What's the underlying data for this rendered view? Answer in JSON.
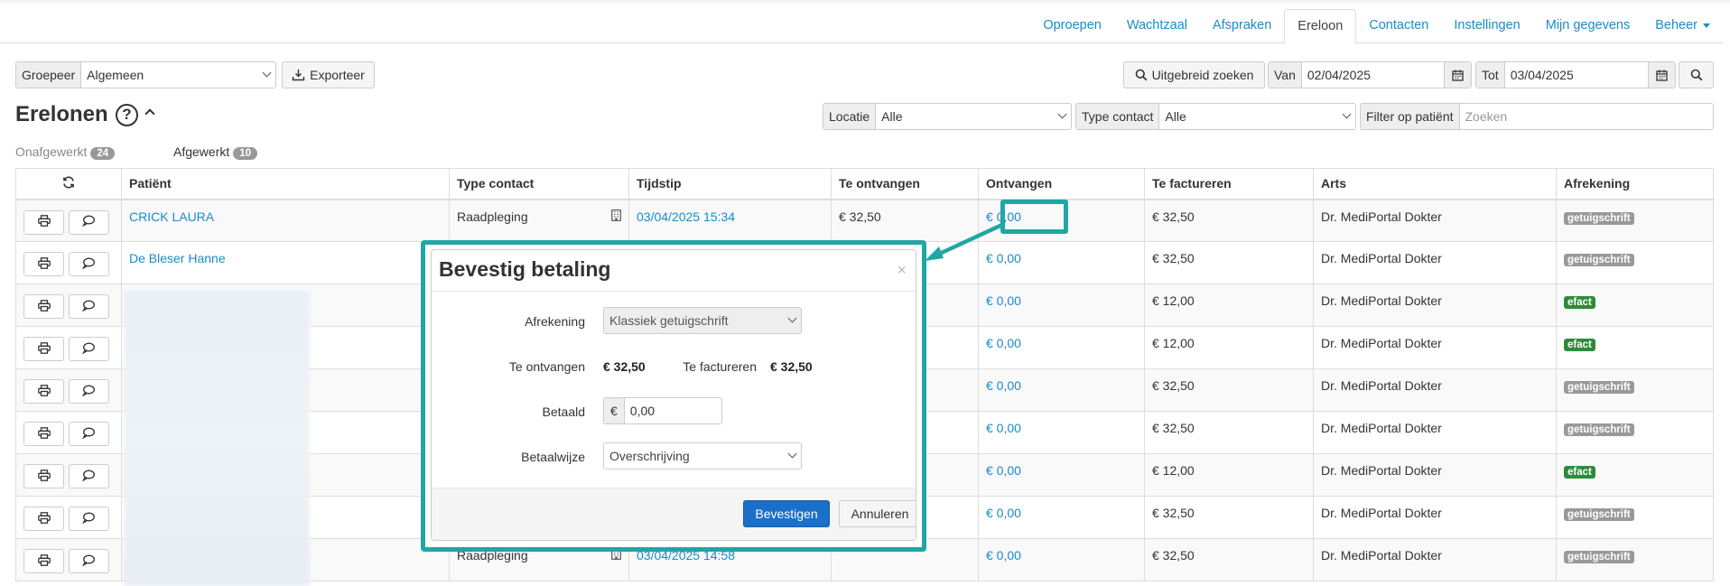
{
  "nav": {
    "tabs": [
      {
        "label": "Oproepen"
      },
      {
        "label": "Wachtzaal"
      },
      {
        "label": "Afspraken"
      },
      {
        "label": "Ereloon"
      },
      {
        "label": "Contacten"
      },
      {
        "label": "Instellingen"
      },
      {
        "label": "Mijn gegevens"
      },
      {
        "label": "Beheer"
      }
    ],
    "active": "Ereloon"
  },
  "toolbar": {
    "groepeer_label": "Groepeer",
    "groepeer_value": "Algemeen",
    "export_label": "Exporteer",
    "advanced_search_label": "Uitgebreid zoeken",
    "van_label": "Van",
    "van_value": "02/04/2025",
    "tot_label": "Tot",
    "tot_value": "03/04/2025"
  },
  "filters": {
    "locatie_label": "Locatie",
    "locatie_value": "Alle",
    "type_label": "Type contact",
    "type_value": "Alle",
    "patient_label": "Filter op patiënt",
    "patient_placeholder": "Zoeken"
  },
  "page": {
    "title": "Erelonen",
    "help": "?",
    "open_label": "Onafgewerkt",
    "open_count": "24",
    "done_label": "Afgewerkt",
    "done_count": "10"
  },
  "table": {
    "headers": [
      "Patiënt",
      "Type contact",
      "Tijdstip",
      "Te ontvangen",
      "Ontvangen",
      "Te factureren",
      "Arts",
      "Afrekening"
    ],
    "rows": [
      {
        "patient": "CRICK LAURA",
        "type": "Raadpleging",
        "time": "03/04/2025 15:34",
        "to_receive": "€ 32,50",
        "received": "€ 0,00",
        "to_invoice": "€ 32,50",
        "doctor": "Dr. MediPortal Dokter",
        "settlement": "getuigschrift",
        "settlement_color": "grey"
      },
      {
        "patient": "De Bleser Hanne",
        "type": "",
        "time": "",
        "to_receive": "",
        "received": "€ 0,00",
        "to_invoice": "€ 32,50",
        "doctor": "Dr. MediPortal Dokter",
        "settlement": "getuigschrift",
        "settlement_color": "grey"
      },
      {
        "patient": "",
        "type": "",
        "time": "",
        "to_receive": "",
        "received": "€ 0,00",
        "to_invoice": "€ 12,00",
        "doctor": "Dr. MediPortal Dokter",
        "settlement": "efact",
        "settlement_color": "green"
      },
      {
        "patient": "",
        "type": "",
        "time": "",
        "to_receive": "",
        "received": "€ 0,00",
        "to_invoice": "€ 12,00",
        "doctor": "Dr. MediPortal Dokter",
        "settlement": "efact",
        "settlement_color": "green"
      },
      {
        "patient": "",
        "type": "",
        "time": "",
        "to_receive": "",
        "received": "€ 0,00",
        "to_invoice": "€ 32,50",
        "doctor": "Dr. MediPortal Dokter",
        "settlement": "getuigschrift",
        "settlement_color": "grey"
      },
      {
        "patient": "",
        "type": "",
        "time": "",
        "to_receive": "",
        "received": "€ 0,00",
        "to_invoice": "€ 32,50",
        "doctor": "Dr. MediPortal Dokter",
        "settlement": "getuigschrift",
        "settlement_color": "grey"
      },
      {
        "patient": "",
        "type": "",
        "time": "",
        "to_receive": "",
        "received": "€ 0,00",
        "to_invoice": "€ 12,00",
        "doctor": "Dr. MediPortal Dokter",
        "settlement": "efact",
        "settlement_color": "green"
      },
      {
        "patient": "",
        "type": "",
        "time": "",
        "to_receive": "",
        "received": "€ 0,00",
        "to_invoice": "€ 32,50",
        "doctor": "Dr. MediPortal Dokter",
        "settlement": "getuigschrift",
        "settlement_color": "grey"
      },
      {
        "patient": "",
        "type": "Raadpleging",
        "time": "03/04/2025 14:58",
        "to_receive": "",
        "received": "€ 0,00",
        "to_invoice": "€ 32,50",
        "doctor": "Dr. MediPortal Dokter",
        "settlement": "getuigschrift",
        "settlement_color": "grey"
      }
    ]
  },
  "modal": {
    "title": "Bevestig betaling",
    "close": "×",
    "afrekening_label": "Afrekening",
    "afrekening_value": "Klassiek getuigschrift",
    "to_receive_label": "Te ontvangen",
    "to_receive_value": "€ 32,50",
    "to_invoice_label": "Te factureren",
    "to_invoice_value": "€ 32,50",
    "betaald_label": "Betaald",
    "currency": "€",
    "betaald_value": "0,00",
    "betaalwijze_label": "Betaalwijze",
    "betaalwijze_value": "Overschrijving",
    "confirm_label": "Bevestigen",
    "cancel_label": "Annuleren"
  },
  "colors": {
    "link": "#1a8ccb",
    "highlight": "#21a6a3",
    "primary": "#1a6fc9",
    "label_grey": "#999999",
    "label_green": "#2e8b3a"
  }
}
